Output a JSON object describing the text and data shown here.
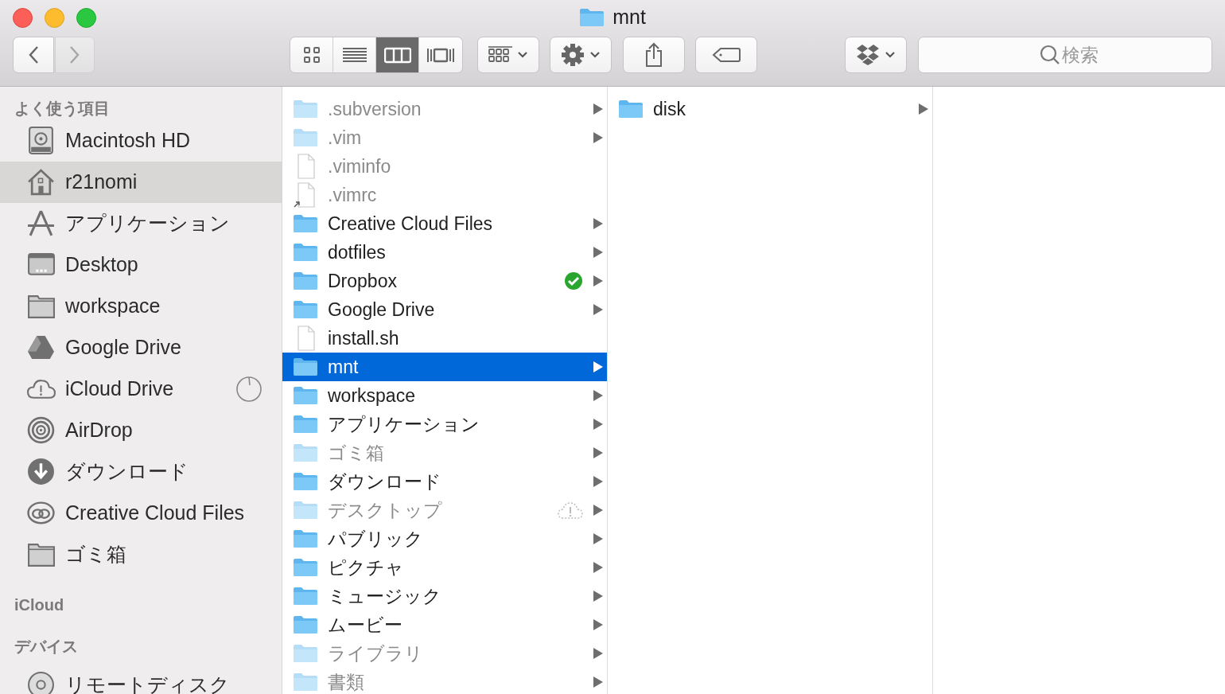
{
  "window": {
    "title": "mnt"
  },
  "toolbar": {
    "back_enabled": true,
    "forward_enabled": false,
    "views": [
      {
        "kind": "icons",
        "selected": false
      },
      {
        "kind": "list",
        "selected": false
      },
      {
        "kind": "columns",
        "selected": true
      },
      {
        "kind": "coverflow",
        "selected": false
      }
    ],
    "search": {
      "placeholder": "検索"
    }
  },
  "sidebar": {
    "sections": [
      {
        "title": "よく使う項目",
        "items": [
          {
            "name": "Macintosh HD",
            "kind": "disk",
            "selected": false,
            "syncing": false
          },
          {
            "name": "r21nomi",
            "kind": "home",
            "selected": true,
            "syncing": false
          },
          {
            "name": "アプリケーション",
            "kind": "apps",
            "selected": false,
            "syncing": false
          },
          {
            "name": "Desktop",
            "kind": "desktop",
            "selected": false,
            "syncing": false
          },
          {
            "name": "workspace",
            "kind": "folder",
            "selected": false,
            "syncing": false
          },
          {
            "name": "Google Drive",
            "kind": "drive",
            "selected": false,
            "syncing": false
          },
          {
            "name": "iCloud Drive",
            "kind": "cloud",
            "selected": false,
            "syncing": true
          },
          {
            "name": "AirDrop",
            "kind": "airdrop",
            "selected": false,
            "syncing": false
          },
          {
            "name": "ダウンロード",
            "kind": "download",
            "selected": false,
            "syncing": false
          },
          {
            "name": "Creative Cloud Files",
            "kind": "cc",
            "selected": false,
            "syncing": false
          },
          {
            "name": "ゴミ箱",
            "kind": "folder",
            "selected": false,
            "syncing": false
          }
        ]
      },
      {
        "title": "iCloud"
      },
      {
        "title": "デバイス",
        "items": [
          {
            "name": "リモートディスク",
            "kind": "disc",
            "selected": false,
            "syncing": false
          }
        ]
      }
    ]
  },
  "columns": [
    {
      "items": [
        {
          "name": ".subversion",
          "kind": "folder",
          "dimmed": true,
          "has_children": true,
          "selected": false,
          "synced": false,
          "cloud_warning": false
        },
        {
          "name": ".vim",
          "kind": "folder",
          "dimmed": true,
          "has_children": true,
          "selected": false,
          "synced": false,
          "cloud_warning": false
        },
        {
          "name": ".viminfo",
          "kind": "file",
          "dimmed": true,
          "has_children": false,
          "selected": false,
          "synced": false,
          "cloud_warning": false
        },
        {
          "name": ".vimrc",
          "kind": "alias",
          "dimmed": true,
          "has_children": false,
          "selected": false,
          "synced": false,
          "cloud_warning": false
        },
        {
          "name": "Creative Cloud Files",
          "kind": "folder",
          "dimmed": false,
          "has_children": true,
          "selected": false,
          "synced": false,
          "cloud_warning": false
        },
        {
          "name": "dotfiles",
          "kind": "folder",
          "dimmed": false,
          "has_children": true,
          "selected": false,
          "synced": false,
          "cloud_warning": false
        },
        {
          "name": "Dropbox",
          "kind": "folder",
          "dimmed": false,
          "has_children": true,
          "selected": false,
          "synced": true,
          "cloud_warning": false
        },
        {
          "name": "Google Drive",
          "kind": "folder",
          "dimmed": false,
          "has_children": true,
          "selected": false,
          "synced": false,
          "cloud_warning": false
        },
        {
          "name": "install.sh",
          "kind": "file",
          "dimmed": false,
          "has_children": false,
          "selected": false,
          "synced": false,
          "cloud_warning": false
        },
        {
          "name": "mnt",
          "kind": "folder",
          "dimmed": false,
          "has_children": true,
          "selected": true,
          "synced": false,
          "cloud_warning": false
        },
        {
          "name": "workspace",
          "kind": "folder",
          "dimmed": false,
          "has_children": true,
          "selected": false,
          "synced": false,
          "cloud_warning": false
        },
        {
          "name": "アプリケーション",
          "kind": "folder",
          "dimmed": false,
          "has_children": true,
          "selected": false,
          "synced": false,
          "cloud_warning": false
        },
        {
          "name": "ゴミ箱",
          "kind": "folder",
          "dimmed": true,
          "has_children": true,
          "selected": false,
          "synced": false,
          "cloud_warning": false
        },
        {
          "name": "ダウンロード",
          "kind": "folder",
          "dimmed": false,
          "has_children": true,
          "selected": false,
          "synced": false,
          "cloud_warning": false
        },
        {
          "name": "デスクトップ",
          "kind": "folder",
          "dimmed": true,
          "has_children": true,
          "selected": false,
          "synced": false,
          "cloud_warning": true
        },
        {
          "name": "パブリック",
          "kind": "folder",
          "dimmed": false,
          "has_children": true,
          "selected": false,
          "synced": false,
          "cloud_warning": false
        },
        {
          "name": "ピクチャ",
          "kind": "folder",
          "dimmed": false,
          "has_children": true,
          "selected": false,
          "synced": false,
          "cloud_warning": false
        },
        {
          "name": "ミュージック",
          "kind": "folder",
          "dimmed": false,
          "has_children": true,
          "selected": false,
          "synced": false,
          "cloud_warning": false
        },
        {
          "name": "ムービー",
          "kind": "folder",
          "dimmed": false,
          "has_children": true,
          "selected": false,
          "synced": false,
          "cloud_warning": false
        },
        {
          "name": "ライブラリ",
          "kind": "folder",
          "dimmed": true,
          "has_children": true,
          "selected": false,
          "synced": false,
          "cloud_warning": false
        },
        {
          "name": "書類",
          "kind": "folder",
          "dimmed": true,
          "has_children": true,
          "selected": false,
          "synced": false,
          "cloud_warning": false
        }
      ]
    },
    {
      "items": [
        {
          "name": "disk",
          "kind": "folder",
          "dimmed": false,
          "has_children": true,
          "selected": false,
          "synced": false,
          "cloud_warning": false
        }
      ]
    }
  ]
}
